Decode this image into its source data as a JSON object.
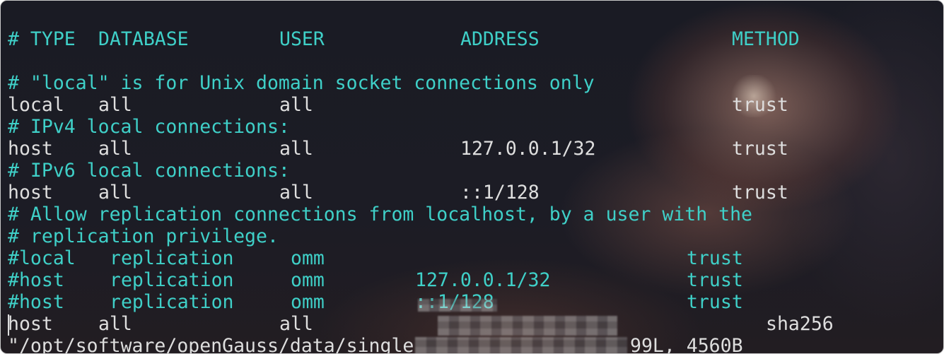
{
  "header": {
    "type": "# TYPE",
    "database": "DATABASE",
    "user": "USER",
    "address": "ADDRESS",
    "method": "METHOD"
  },
  "comments": {
    "local": "# \"local\" is for Unix domain socket connections only",
    "ipv4": "# IPv4 local connections:",
    "ipv6": "# IPv6 local connections:",
    "replication1": "# Allow replication connections from localhost, by a user with the",
    "replication2": "# replication privilege."
  },
  "entries": {
    "local": {
      "type": "local",
      "database": "all",
      "user": "all",
      "address": "",
      "method": "trust"
    },
    "host_v4": {
      "type": "host",
      "database": "all",
      "user": "all",
      "address": "127.0.0.1/32",
      "method": "trust"
    },
    "host_v6": {
      "type": "host",
      "database": "all",
      "user": "all",
      "address": "::1/128",
      "method": "trust"
    },
    "rep_local": {
      "type": "#local",
      "database": "replication",
      "user": "omm",
      "address": "",
      "method": "trust"
    },
    "rep_host_v4": {
      "type": "#host",
      "database": "replication",
      "user": "omm",
      "address": "127.0.0.1/32",
      "method": "trust"
    },
    "rep_host_v6": {
      "type": "#host",
      "database": "replication",
      "user": "omm",
      "address": "::1/128",
      "method": "trust"
    },
    "custom": {
      "type": "host",
      "database": "all",
      "user": "all",
      "method": "sha256"
    }
  },
  "status": {
    "file_path": "\"/opt/software/openGauss/data/single",
    "file_info": "99L, 4560B"
  }
}
